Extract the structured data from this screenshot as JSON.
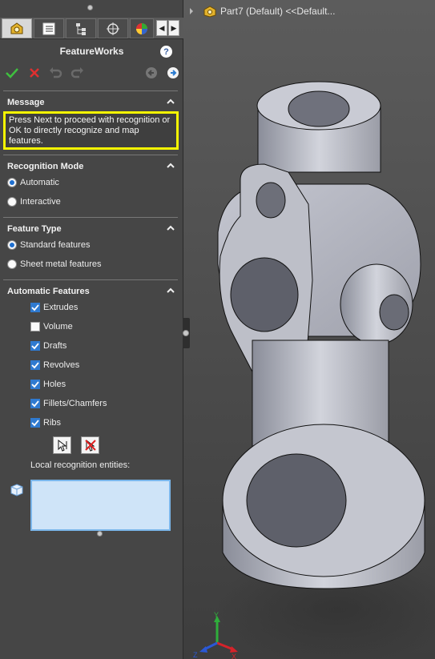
{
  "panel": {
    "title": "FeatureWorks",
    "help_label": "?",
    "tabs": [
      "featureworks-tab",
      "property-manager-tab",
      "configuration-tab",
      "dimxpert-tab",
      "appearance-tab"
    ],
    "message": {
      "header": "Message",
      "text": "Press Next to proceed with recognition or OK to directly recognize and map features."
    },
    "recognition_mode": {
      "header": "Recognition Mode",
      "options": [
        "Automatic",
        "Interactive"
      ],
      "selected": "Automatic"
    },
    "feature_type": {
      "header": "Feature Type",
      "options": [
        "Standard features",
        "Sheet metal features"
      ],
      "selected": "Standard features"
    },
    "automatic_features": {
      "header": "Automatic Features",
      "items": [
        {
          "label": "Extrudes",
          "checked": true
        },
        {
          "label": "Volume",
          "checked": false
        },
        {
          "label": "Drafts",
          "checked": true
        },
        {
          "label": "Revolves",
          "checked": true
        },
        {
          "label": "Holes",
          "checked": true
        },
        {
          "label": "Fillets/Chamfers",
          "checked": true
        },
        {
          "label": "Ribs",
          "checked": true
        }
      ]
    },
    "local_recognition_label": "Local recognition entities:"
  },
  "viewport": {
    "tree_label": "Part7 (Default) <<Default..."
  },
  "colors": {
    "panel_bg": "#464646",
    "highlight": "#f6f600",
    "accent": "#1e6fd0",
    "list_bg": "#cfe4f8"
  }
}
